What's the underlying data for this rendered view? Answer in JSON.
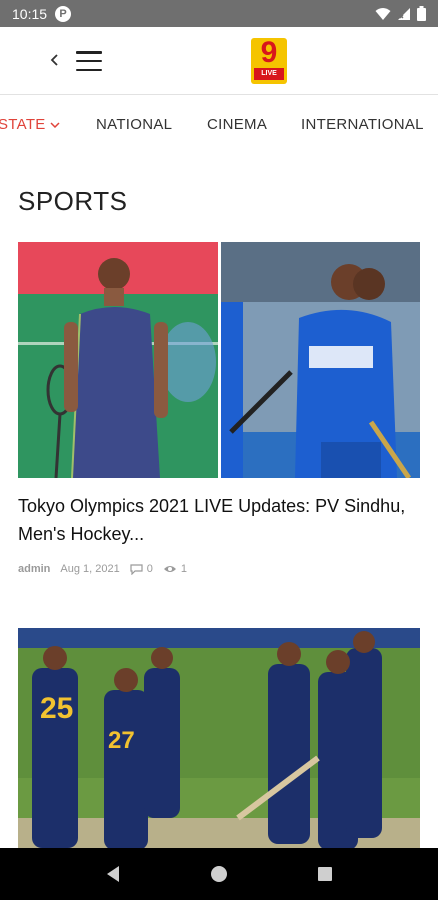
{
  "status_bar": {
    "time": "10:15",
    "app_badge": "P"
  },
  "header": {
    "back_icon": "chevron-left-icon",
    "menu_icon": "hamburger-icon",
    "logo_text": "9",
    "logo_subtext": "LIVE",
    "logo_colors": {
      "background": "#f5c400",
      "accent": "#d8161c"
    }
  },
  "tabs": [
    {
      "label": "STATE",
      "active": true
    },
    {
      "label": "NATIONAL",
      "active": false
    },
    {
      "label": "CINEMA",
      "active": false
    },
    {
      "label": "INTERNATIONAL",
      "active": false
    }
  ],
  "section": {
    "title": "SPORTS"
  },
  "articles": [
    {
      "title": "Tokyo Olympics 2021 LIVE Updates: PV Sindhu, Men's Hockey...",
      "author": "admin",
      "date": "Aug 1, 2021",
      "comments": "0",
      "views": "1"
    }
  ],
  "colors": {
    "accent": "#e0433a",
    "status_bar": "#6f6f6f",
    "nav_bar": "#000000"
  }
}
